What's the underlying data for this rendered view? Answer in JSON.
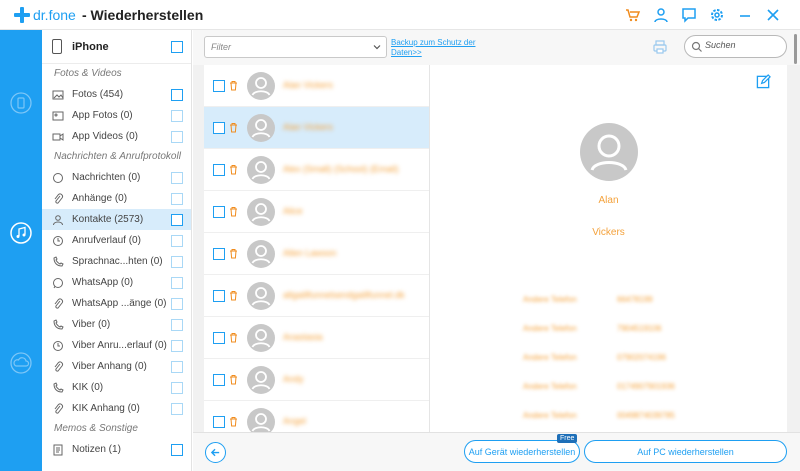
{
  "app": {
    "logo_text": "dr.fone",
    "title": "- Wiederherstellen"
  },
  "colors": {
    "accent": "#1e9ff2",
    "highlight": "#f4a23c",
    "selected_bg": "#d7ecfb"
  },
  "titlebar_icons": [
    "cart-icon",
    "user-icon",
    "feedback-icon",
    "settings-icon",
    "minimize-icon",
    "close-icon"
  ],
  "rail": {
    "items": [
      "device-restore-icon",
      "music-restore-icon",
      "cloud-restore-icon"
    ],
    "active": 1
  },
  "sidebar": {
    "device": "iPhone",
    "sections": [
      {
        "title": "Fotos & Videos",
        "items": [
          {
            "label": "Fotos (454)",
            "icon": "photo-icon",
            "enabled": true
          },
          {
            "label": "App Fotos (0)",
            "icon": "app-photo-icon",
            "enabled": false
          },
          {
            "label": "App Videos (0)",
            "icon": "video-icon",
            "enabled": false
          }
        ]
      },
      {
        "title": "Nachrichten & Anrufprotokoll",
        "items": [
          {
            "label": "Nachrichten (0)",
            "icon": "message-icon",
            "enabled": false
          },
          {
            "label": "Anhänge (0)",
            "icon": "attachment-icon",
            "enabled": false
          },
          {
            "label": "Kontakte (2573)",
            "icon": "contact-icon",
            "enabled": true,
            "active": true
          },
          {
            "label": "Anrufverlauf (0)",
            "icon": "call-history-icon",
            "enabled": false
          },
          {
            "label": "Sprachnac...hten (0)",
            "icon": "voicemail-icon",
            "enabled": false
          },
          {
            "label": "WhatsApp (0)",
            "icon": "whatsapp-icon",
            "enabled": false
          },
          {
            "label": "WhatsApp ...änge (0)",
            "icon": "whatsapp-attachment-icon",
            "enabled": false
          },
          {
            "label": "Viber (0)",
            "icon": "viber-icon",
            "enabled": false
          },
          {
            "label": "Viber Anru...erlauf (0)",
            "icon": "viber-call-icon",
            "enabled": false
          },
          {
            "label": "Viber Anhang (0)",
            "icon": "viber-attachment-icon",
            "enabled": false
          },
          {
            "label": "KIK (0)",
            "icon": "kik-icon",
            "enabled": false
          },
          {
            "label": "KIK Anhang (0)",
            "icon": "kik-attachment-icon",
            "enabled": false
          }
        ]
      },
      {
        "title": "Memos & Sonstige",
        "items": [
          {
            "label": "Notizen (1)",
            "icon": "notes-icon",
            "enabled": true
          }
        ]
      }
    ]
  },
  "toolbar": {
    "filter_placeholder": "Filter",
    "backup_link": "Backup zum Schutz der Daten>>",
    "search_placeholder": "Suchen"
  },
  "contacts": [
    {
      "name": "Alan Vickers",
      "selected": false
    },
    {
      "name": "Alan Vickers",
      "selected": true
    },
    {
      "name": "Alex (Small) (School) (Email)",
      "selected": false
    },
    {
      "name": "Alice",
      "selected": false
    },
    {
      "name": "Allen Lawson",
      "selected": false
    },
    {
      "name": "allgaillfunnelsendgaillfunnel.dk",
      "selected": false
    },
    {
      "name": "Anastasia",
      "selected": false
    },
    {
      "name": "Andy",
      "selected": false
    },
    {
      "name": "Angel",
      "selected": false
    }
  ],
  "detail": {
    "first_name": "Alan",
    "last_name": "Vickers",
    "fields": [
      {
        "label": "Andere Telefon",
        "value": "66478199"
      },
      {
        "label": "Andere Telefon",
        "value": "7904519106"
      },
      {
        "label": "Andere Telefon",
        "value": "07902074196"
      },
      {
        "label": "Andere Telefon",
        "value": "0174907901936"
      },
      {
        "label": "Andere Telefon",
        "value": "0049874039785"
      },
      {
        "label": "Andere Telefon",
        "value": "7867902876"
      }
    ]
  },
  "footer": {
    "device_button": "Auf Gerät wiederherstellen",
    "free_badge": "Free",
    "pc_button": "Auf PC wiederherstellen"
  }
}
